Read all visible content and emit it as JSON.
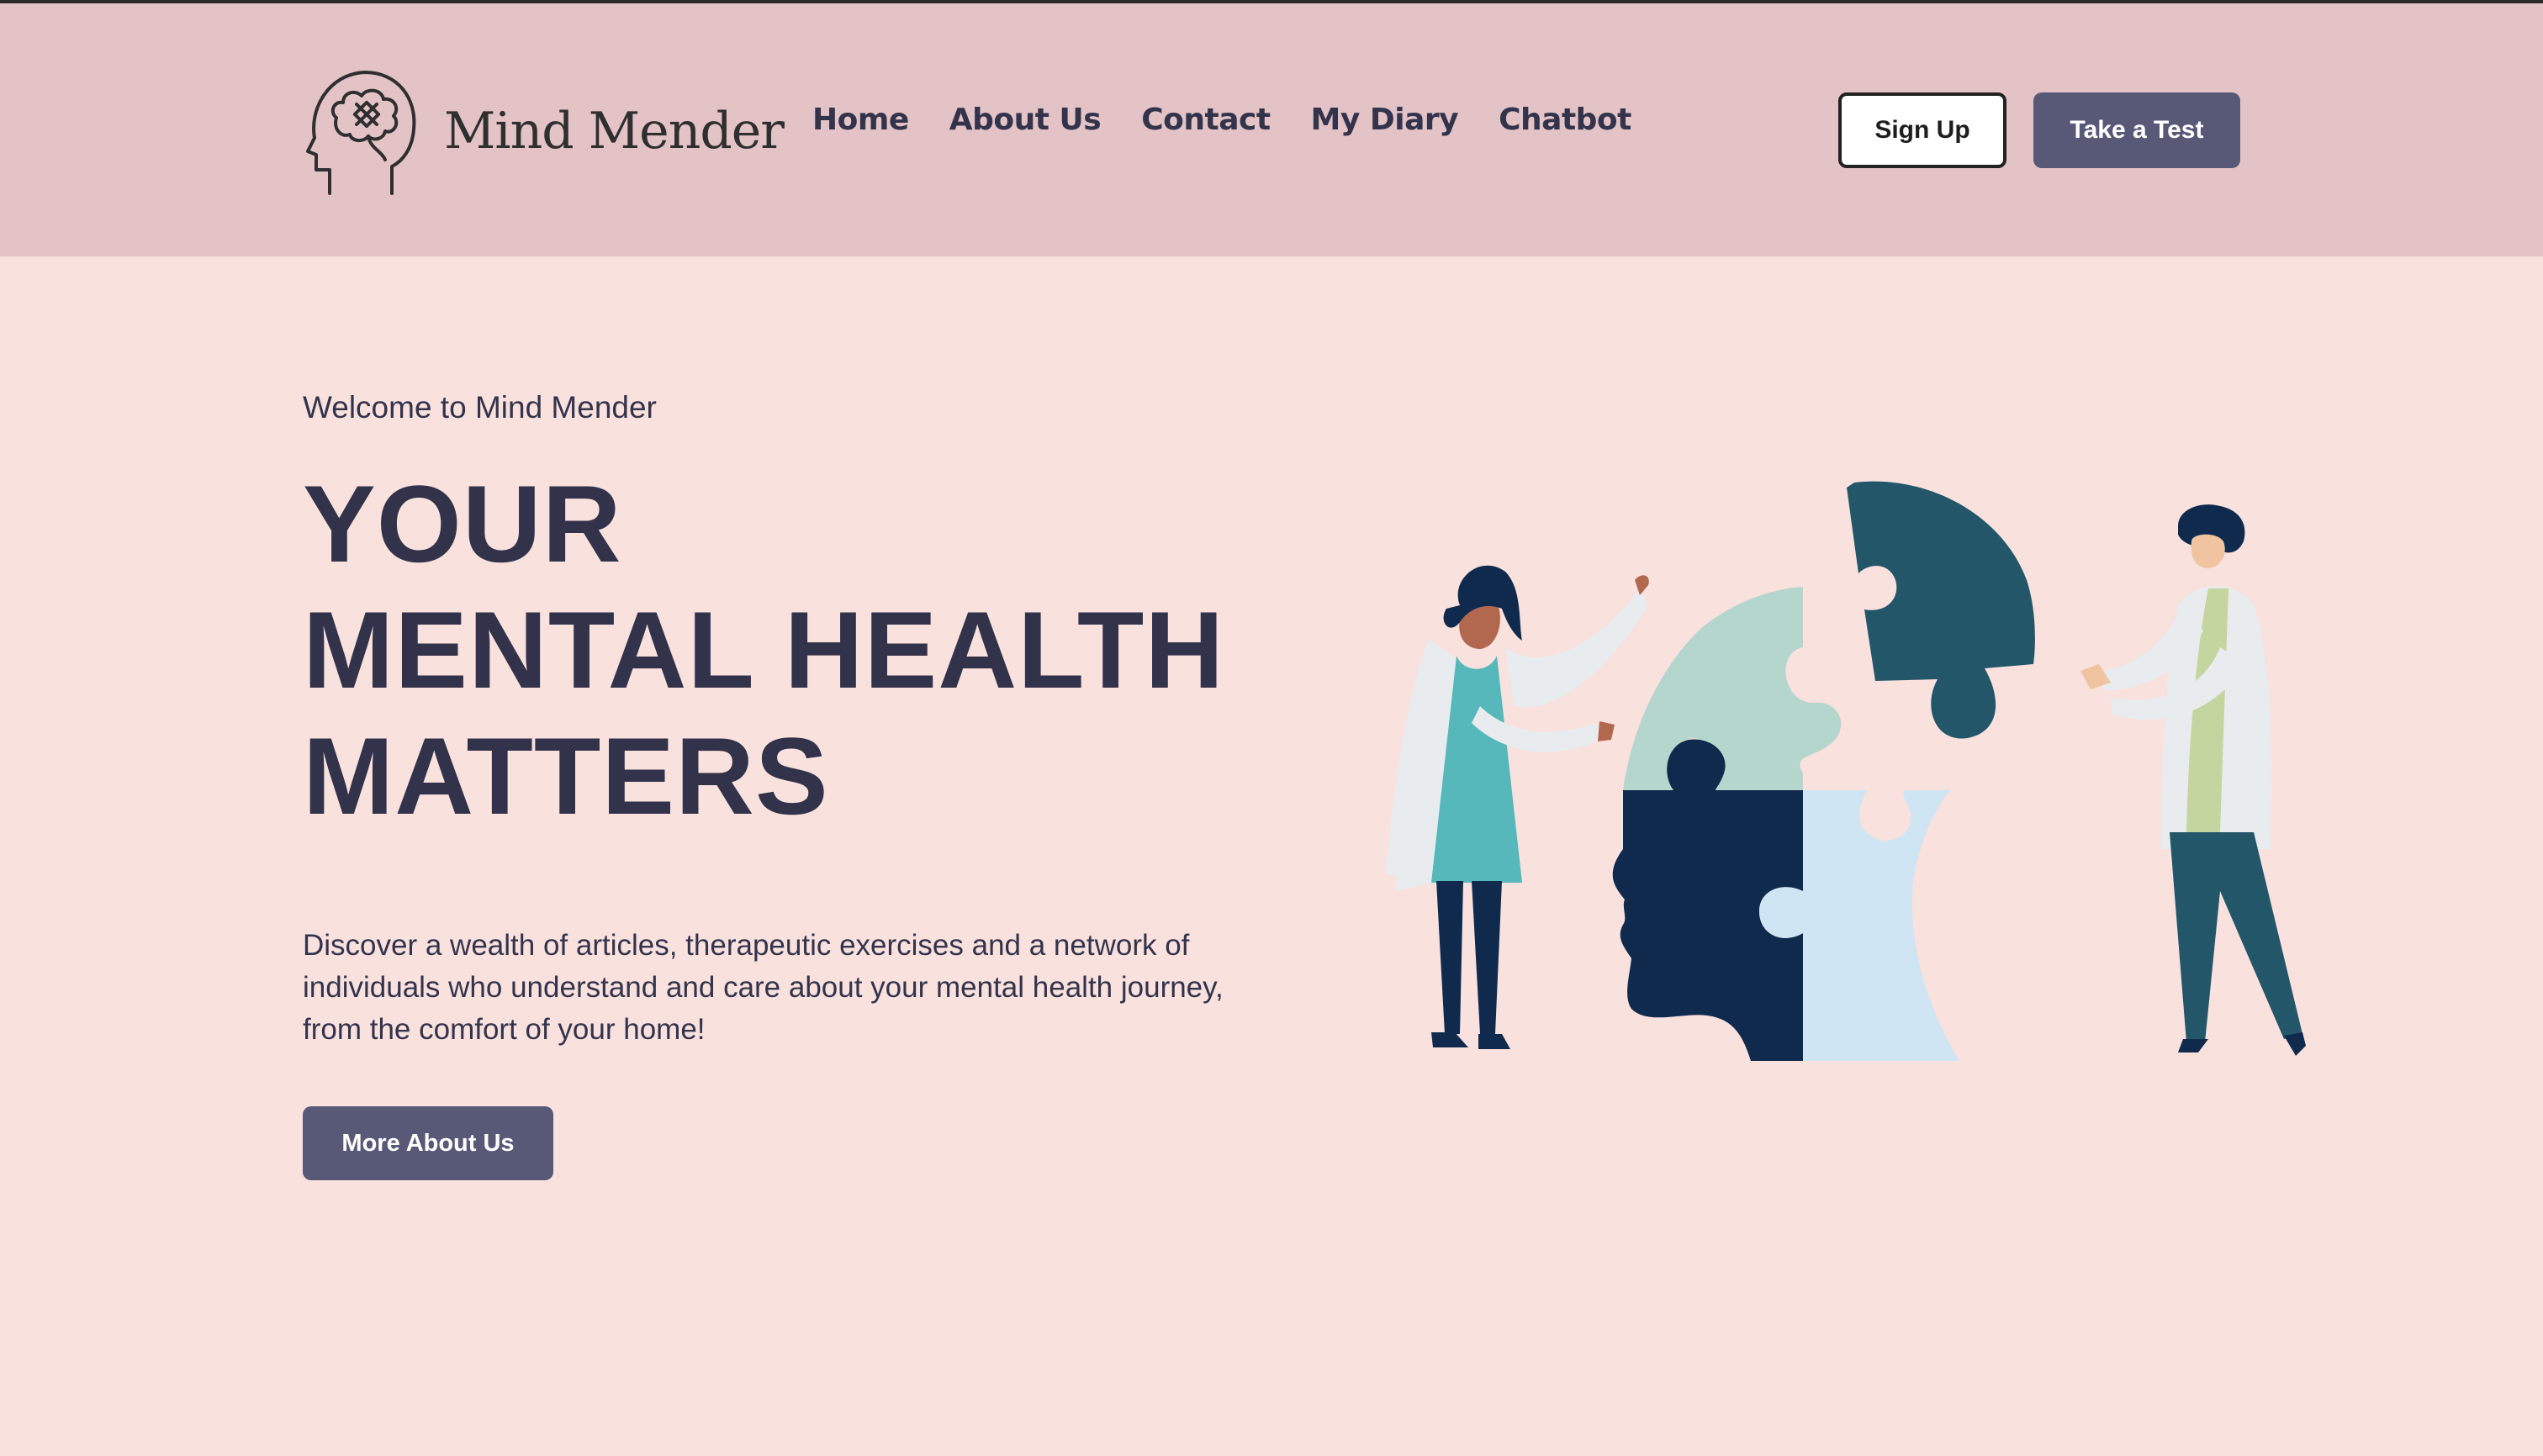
{
  "brand": {
    "name": "Mind Mender",
    "logo_icon": "head-brain-bandage-icon"
  },
  "nav": {
    "items": [
      {
        "label": "Home"
      },
      {
        "label": "About Us"
      },
      {
        "label": "Contact"
      },
      {
        "label": "My Diary"
      },
      {
        "label": "Chatbot"
      }
    ]
  },
  "header_actions": {
    "signup_label": "Sign Up",
    "test_label": "Take a Test"
  },
  "hero": {
    "welcome": "Welcome to Mind Mender",
    "headline_lines": [
      "YOUR",
      "MENTAL HEALTH",
      "MATTERS"
    ],
    "description": "Discover a wealth of articles, therapeutic exercises and a network of individuals who understand and care about your mental health journey, from the comfort of your home!",
    "cta_label": "More About Us",
    "illustration": "two-people-assembling-head-puzzle-illustration"
  },
  "colors": {
    "header_bg": "#e3c3c6",
    "page_bg": "#f9e1de",
    "primary_button": "#575977",
    "text_dark": "#32324a",
    "puzzle_mint": "#b4d6cd",
    "puzzle_teal": "#235669",
    "puzzle_navy": "#0f2a4d",
    "puzzle_light_blue": "#cfe5f4"
  }
}
